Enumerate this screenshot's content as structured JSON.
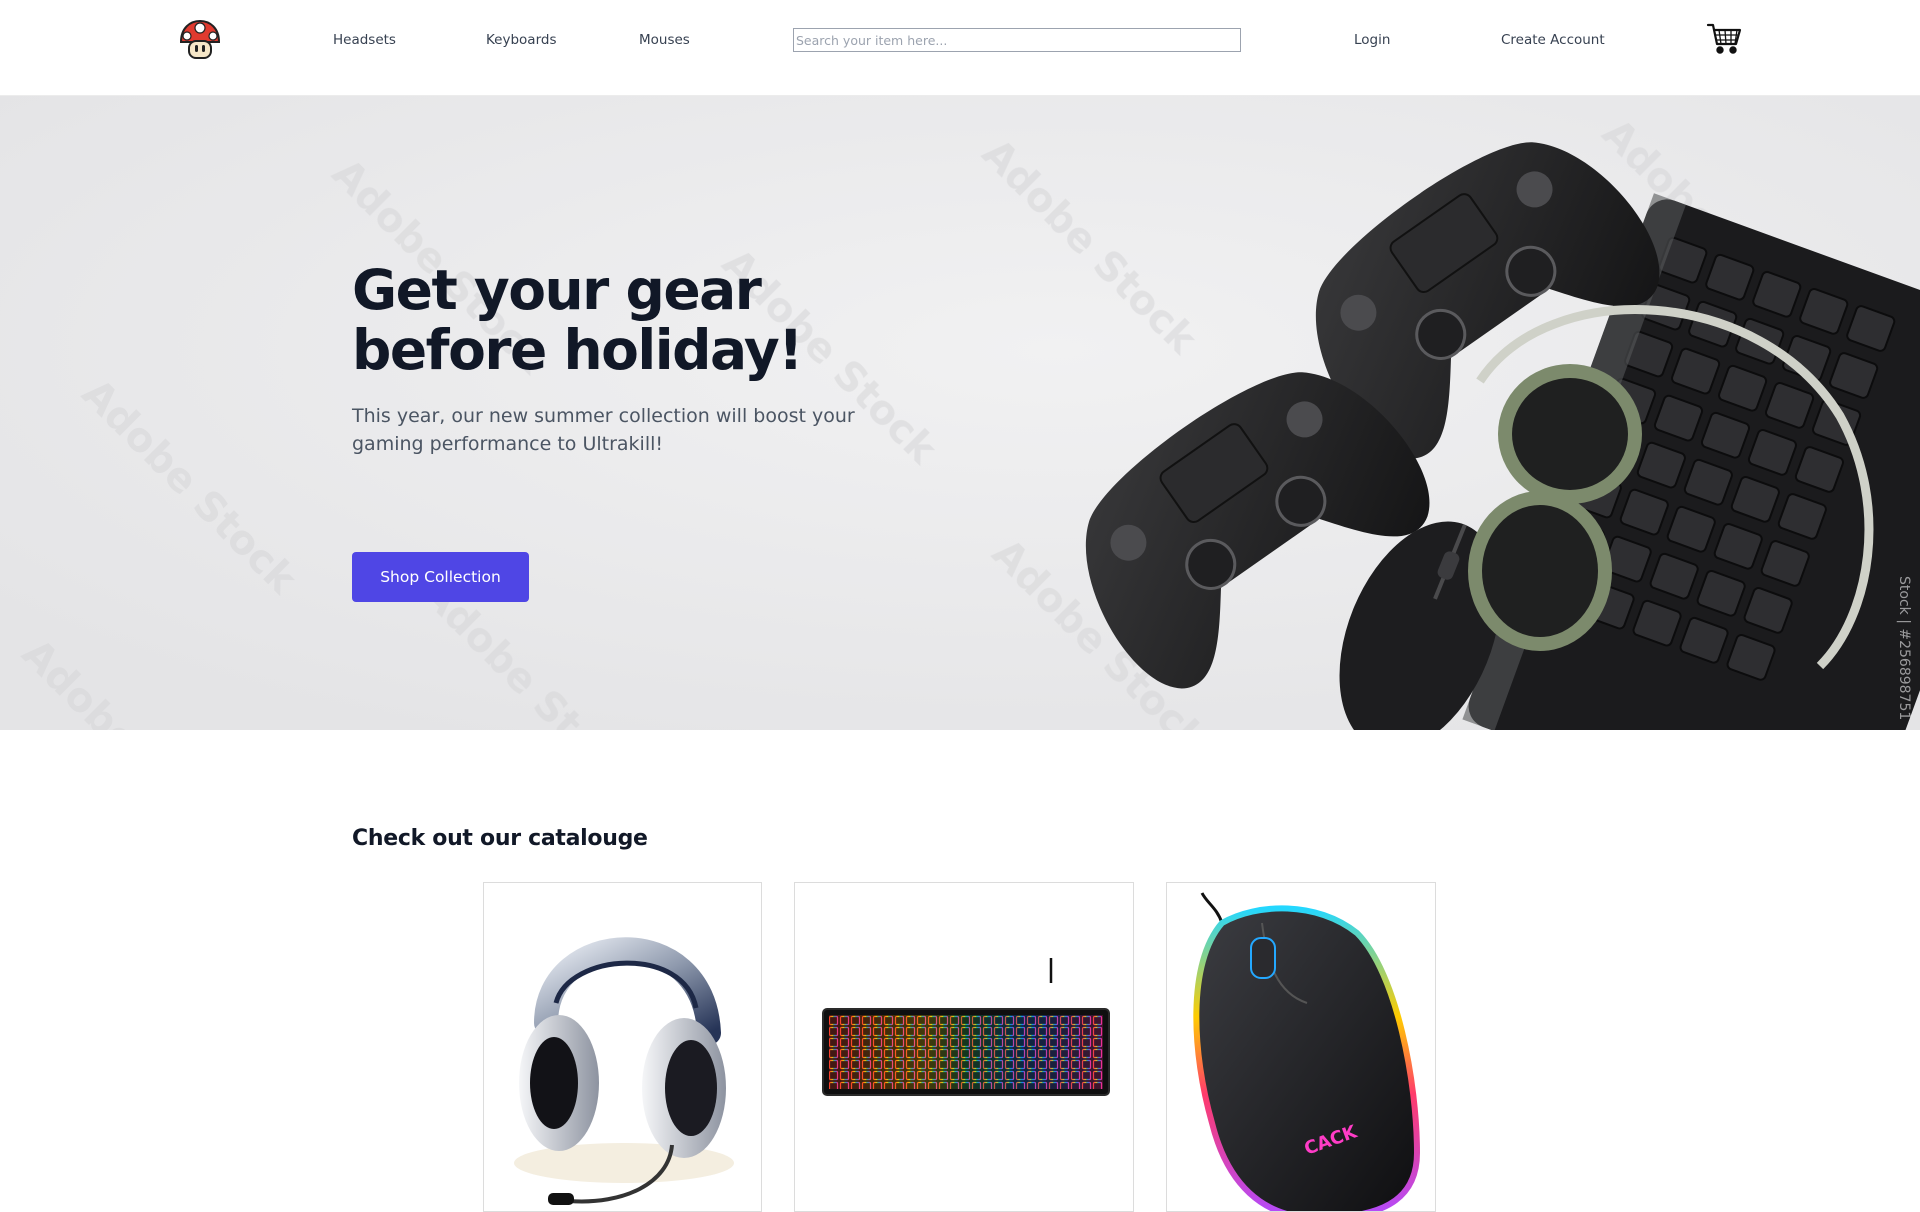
{
  "nav": {
    "logo_icon": "mushroom-logo-icon",
    "links": [
      "Headsets",
      "Keyboards",
      "Mouses"
    ],
    "search_placeholder": "Search your item here...",
    "login": "Login",
    "create_account": "Create Account",
    "cart_icon": "shopping-cart-icon"
  },
  "hero": {
    "title": "Get your gear before holiday!",
    "subtitle": "This year, our new summer collection will boost your gaming performance to Ultrakill!",
    "button": "Shop Collection",
    "watermark": "Adobe Stock",
    "side_caption": "Stock | #256898751"
  },
  "catalogue": {
    "title": "Check out our catalouge",
    "products": [
      {
        "icon": "headset-icon"
      },
      {
        "icon": "rgb-keyboard-icon"
      },
      {
        "icon": "gaming-mouse-icon",
        "brand": "CACK"
      }
    ]
  },
  "colors": {
    "accent": "#4f46e5",
    "hero_bg": "#e9e9ea",
    "heading": "#111827"
  }
}
